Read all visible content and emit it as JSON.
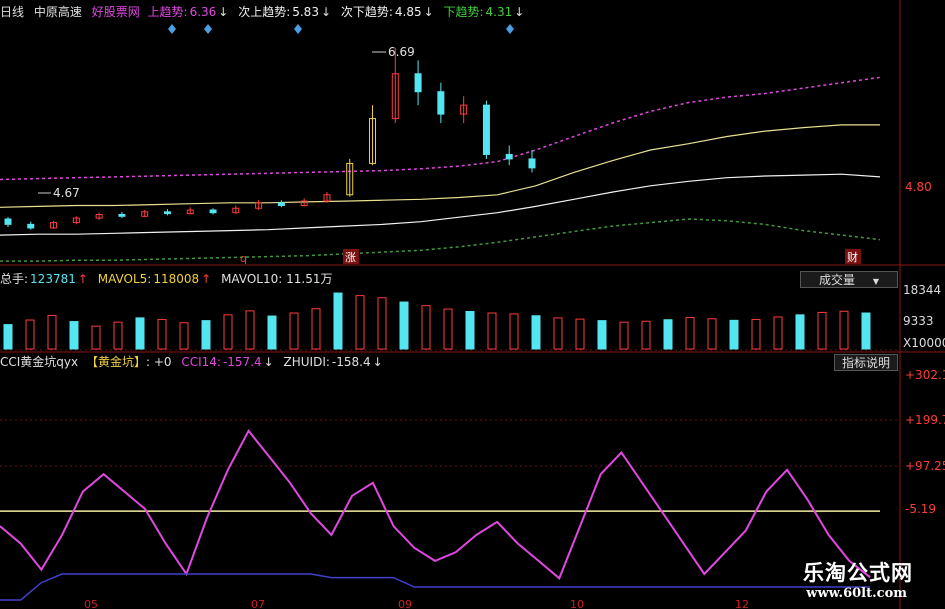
{
  "header": {
    "period": "日线",
    "stock_name": "中原高速",
    "indicator_name": "好股票网",
    "upper_trend_label": "上趋势:",
    "upper_trend_value": "6.36",
    "next_upper_label": "次上趋势:",
    "next_upper_value": "5.83",
    "next_lower_label": "次下趋势:",
    "next_lower_value": "4.85",
    "lower_trend_label": "下趋势:",
    "lower_trend_value": "4.31",
    "down_arrow": "↓"
  },
  "volume_header": {
    "total_label": "总手:",
    "total_value": "123781",
    "mavol5_label": "MAVOL5:",
    "mavol5_value": "118008",
    "mavol10_partial": "MAVOL10: 11.51万",
    "up_arrow": "↑",
    "button": "成交量",
    "dropdown_icon": "triangle-down-icon"
  },
  "cci_header": {
    "name": "CCI黄金坑qyx",
    "tag": "【黄金坑】",
    "tag_value": ": +0",
    "cci_label": "CCI14:",
    "cci_value": "-157.4",
    "zhuidi_label": "ZHUIDI:",
    "zhuidi_value": "-158.4",
    "down_arrow": "↓",
    "button": "指标说明"
  },
  "price_axis": {
    "label": "4.80"
  },
  "volume_axis": {
    "labels": [
      "18344",
      "9333",
      "X10000"
    ]
  },
  "cci_axis": {
    "labels": [
      "+302.1",
      "+199.7",
      "+97.25",
      "-5.19"
    ]
  },
  "annotations": {
    "high": "6.69",
    "low": "4.67",
    "marker_q": "q",
    "marker_zhang": "涨",
    "marker_cai": "财"
  },
  "x_axis": {
    "labels": [
      "05",
      "07",
      "09",
      "10",
      "12"
    ]
  },
  "watermark": {
    "title": "乐淘公式网",
    "url": "www.60lt.com"
  },
  "colors": {
    "background": "#000000",
    "up_candle": "#ff3b3b",
    "down_candle": "#54e6f0",
    "gold_candle": "#f0d040",
    "magenta": "#e048e0",
    "green_band": "#3f9a3a",
    "yellow_line": "#e8e090",
    "white_line": "#f0f0f0",
    "blue_line": "#4040c8",
    "grid_red": "#7a1010"
  },
  "chart_data": [
    {
      "type": "candlestick",
      "title": "日线 中原高速",
      "ylabel": "",
      "ylim": [
        4.3,
        7.0
      ],
      "series": [
        {
          "name": "上趋势",
          "values": [
            5.22,
            5.23,
            5.24,
            5.25,
            5.26,
            5.27,
            5.28,
            5.29,
            5.3,
            5.31,
            5.32,
            5.34,
            5.37,
            5.42,
            5.55,
            5.7,
            5.85,
            5.98,
            6.08,
            6.14,
            6.18,
            6.24,
            6.3,
            6.36
          ]
        },
        {
          "name": "次上趋势",
          "values": [
            4.91,
            4.92,
            4.93,
            4.93,
            4.94,
            4.95,
            4.96,
            4.96,
            4.97,
            4.98,
            4.99,
            5.0,
            5.02,
            5.05,
            5.15,
            5.3,
            5.43,
            5.55,
            5.62,
            5.7,
            5.76,
            5.8,
            5.83,
            5.83
          ]
        },
        {
          "name": "次下趋势",
          "values": [
            4.6,
            4.61,
            4.61,
            4.62,
            4.63,
            4.64,
            4.65,
            4.66,
            4.68,
            4.7,
            4.72,
            4.75,
            4.8,
            4.85,
            4.92,
            5.0,
            5.08,
            5.15,
            5.2,
            5.24,
            5.26,
            5.27,
            5.28,
            5.25
          ]
        },
        {
          "name": "下趋势",
          "values": [
            4.31,
            4.31,
            4.32,
            4.32,
            4.33,
            4.34,
            4.35,
            4.36,
            4.37,
            4.39,
            4.41,
            4.43,
            4.47,
            4.52,
            4.58,
            4.64,
            4.7,
            4.74,
            4.78,
            4.76,
            4.72,
            4.65,
            4.6,
            4.55
          ]
        }
      ],
      "candles": [
        {
          "o": 4.78,
          "c": 4.72,
          "h": 4.8,
          "l": 4.69
        },
        {
          "o": 4.72,
          "c": 4.68,
          "h": 4.75,
          "l": 4.66
        },
        {
          "o": 4.68,
          "c": 4.74,
          "h": 4.76,
          "l": 4.67
        },
        {
          "o": 4.74,
          "c": 4.79,
          "h": 4.81,
          "l": 4.72
        },
        {
          "o": 4.79,
          "c": 4.83,
          "h": 4.85,
          "l": 4.77
        },
        {
          "o": 4.83,
          "c": 4.81,
          "h": 4.86,
          "l": 4.79
        },
        {
          "o": 4.81,
          "c": 4.86,
          "h": 4.88,
          "l": 4.8
        },
        {
          "o": 4.86,
          "c": 4.84,
          "h": 4.89,
          "l": 4.82
        },
        {
          "o": 4.84,
          "c": 4.88,
          "h": 4.91,
          "l": 4.83
        },
        {
          "o": 4.88,
          "c": 4.85,
          "h": 4.9,
          "l": 4.83
        },
        {
          "o": 4.85,
          "c": 4.9,
          "h": 4.93,
          "l": 4.84
        },
        {
          "o": 4.9,
          "c": 4.96,
          "h": 4.99,
          "l": 4.88
        },
        {
          "o": 4.96,
          "c": 4.93,
          "h": 4.99,
          "l": 4.91
        },
        {
          "o": 4.93,
          "c": 4.98,
          "h": 5.01,
          "l": 4.92
        },
        {
          "o": 4.98,
          "c": 5.05,
          "h": 5.08,
          "l": 4.96
        },
        {
          "o": 5.05,
          "c": 5.4,
          "h": 5.45,
          "l": 5.03
        },
        {
          "o": 5.4,
          "c": 5.9,
          "h": 6.05,
          "l": 5.38
        },
        {
          "o": 5.9,
          "c": 6.4,
          "h": 6.69,
          "l": 5.85
        },
        {
          "o": 6.4,
          "c": 6.2,
          "h": 6.55,
          "l": 6.05
        },
        {
          "o": 6.2,
          "c": 5.95,
          "h": 6.3,
          "l": 5.85
        },
        {
          "o": 5.95,
          "c": 6.05,
          "h": 6.15,
          "l": 5.85
        },
        {
          "o": 6.05,
          "c": 5.5,
          "h": 6.1,
          "l": 5.45
        },
        {
          "o": 5.5,
          "c": 5.45,
          "h": 5.6,
          "l": 5.38
        },
        {
          "o": 5.45,
          "c": 5.35,
          "h": 5.55,
          "l": 5.3
        }
      ],
      "annotations": [
        "6.69",
        "4.67"
      ]
    },
    {
      "type": "bar",
      "title": "成交量",
      "ylim": [
        0,
        20000
      ],
      "values": [
        8000,
        9500,
        11000,
        9000,
        7500,
        8800,
        10200,
        9700,
        8600,
        9300,
        11200,
        12500,
        10800,
        11800,
        13200,
        18344,
        17500,
        16800,
        15400,
        14200,
        13100,
        12300,
        11800,
        11500,
        10900,
        10200,
        9800,
        9300,
        8800,
        9100,
        9600,
        10300,
        9900,
        9400,
        9700,
        10500,
        11200,
        12000,
        12378,
        11800
      ]
    },
    {
      "type": "line",
      "title": "CCI黄金坑qyx",
      "ylim": [
        -210,
        320
      ],
      "series": [
        {
          "name": "CCI14",
          "values": [
            -40,
            -80,
            -140,
            -60,
            40,
            80,
            40,
            0,
            -80,
            -150,
            -20,
            90,
            180,
            120,
            60,
            -10,
            -60,
            30,
            60,
            -40,
            -90,
            -120,
            -100,
            -60,
            -30,
            -80,
            -120,
            -160,
            -40,
            80,
            130,
            60,
            -10,
            -80,
            -150,
            -100,
            -50,
            40,
            90,
            20,
            -60,
            -120,
            -157.4
          ]
        },
        {
          "name": "ZHUIDI",
          "values": [
            -210,
            -210,
            -170,
            -150,
            -150,
            -150,
            -150,
            -150,
            -150,
            -150,
            -150,
            -150,
            -150,
            -150,
            -150,
            -150,
            -158.4,
            -158.4,
            -158.4,
            -158.4,
            -180,
            -180,
            -180,
            -180,
            -180,
            -180,
            -180,
            -180,
            -180,
            -180,
            -180,
            -180,
            -180,
            -180,
            -180,
            -180,
            -180,
            -180,
            -180,
            -180,
            -180,
            -180,
            -180
          ]
        }
      ],
      "reference_line": -5.19
    }
  ]
}
